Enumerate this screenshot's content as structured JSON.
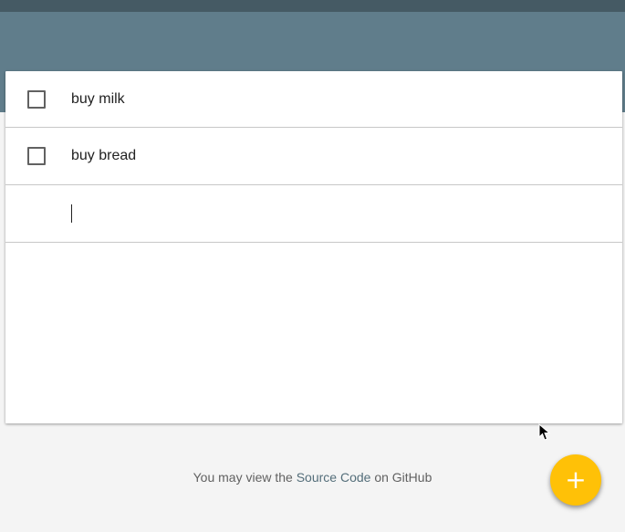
{
  "todos": {
    "items": [
      {
        "label": "buy milk",
        "checked": false
      },
      {
        "label": "buy bread",
        "checked": false
      }
    ],
    "new_item": {
      "value": "",
      "placeholder": ""
    }
  },
  "footer": {
    "prefix": "You may view the ",
    "link_label": "Source Code",
    "suffix": " on GitHub"
  },
  "fab": {
    "icon": "plus-icon",
    "glyph": "+"
  },
  "colors": {
    "status_bar": "#455a64",
    "app_bar": "#607d8b",
    "accent": "#ffc107",
    "link": "#546e7a"
  }
}
